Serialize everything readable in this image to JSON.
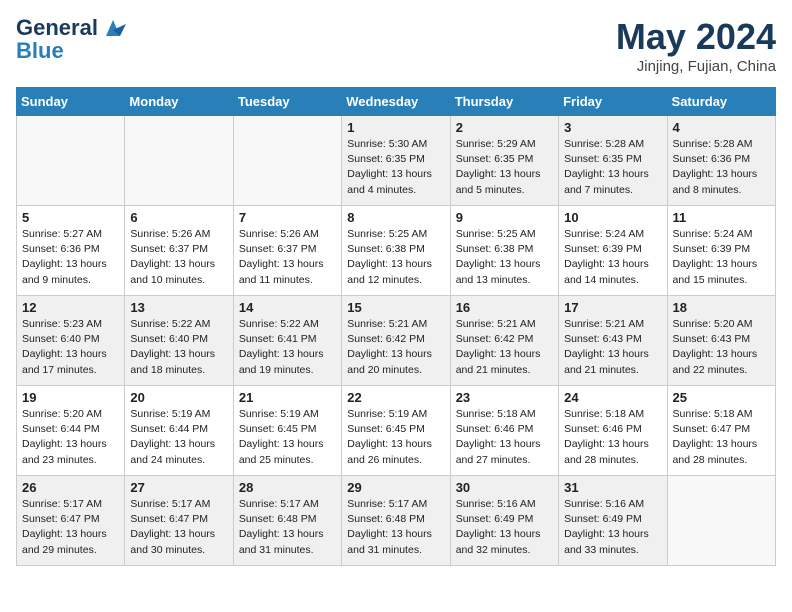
{
  "header": {
    "logo_line1": "General",
    "logo_line2": "Blue",
    "month_title": "May 2024",
    "location": "Jinjing, Fujian, China"
  },
  "weekdays": [
    "Sunday",
    "Monday",
    "Tuesday",
    "Wednesday",
    "Thursday",
    "Friday",
    "Saturday"
  ],
  "rows": [
    [
      {
        "day": "",
        "info": ""
      },
      {
        "day": "",
        "info": ""
      },
      {
        "day": "",
        "info": ""
      },
      {
        "day": "1",
        "info": "Sunrise: 5:30 AM\nSunset: 6:35 PM\nDaylight: 13 hours\nand 4 minutes."
      },
      {
        "day": "2",
        "info": "Sunrise: 5:29 AM\nSunset: 6:35 PM\nDaylight: 13 hours\nand 5 minutes."
      },
      {
        "day": "3",
        "info": "Sunrise: 5:28 AM\nSunset: 6:35 PM\nDaylight: 13 hours\nand 7 minutes."
      },
      {
        "day": "4",
        "info": "Sunrise: 5:28 AM\nSunset: 6:36 PM\nDaylight: 13 hours\nand 8 minutes."
      }
    ],
    [
      {
        "day": "5",
        "info": "Sunrise: 5:27 AM\nSunset: 6:36 PM\nDaylight: 13 hours\nand 9 minutes."
      },
      {
        "day": "6",
        "info": "Sunrise: 5:26 AM\nSunset: 6:37 PM\nDaylight: 13 hours\nand 10 minutes."
      },
      {
        "day": "7",
        "info": "Sunrise: 5:26 AM\nSunset: 6:37 PM\nDaylight: 13 hours\nand 11 minutes."
      },
      {
        "day": "8",
        "info": "Sunrise: 5:25 AM\nSunset: 6:38 PM\nDaylight: 13 hours\nand 12 minutes."
      },
      {
        "day": "9",
        "info": "Sunrise: 5:25 AM\nSunset: 6:38 PM\nDaylight: 13 hours\nand 13 minutes."
      },
      {
        "day": "10",
        "info": "Sunrise: 5:24 AM\nSunset: 6:39 PM\nDaylight: 13 hours\nand 14 minutes."
      },
      {
        "day": "11",
        "info": "Sunrise: 5:24 AM\nSunset: 6:39 PM\nDaylight: 13 hours\nand 15 minutes."
      }
    ],
    [
      {
        "day": "12",
        "info": "Sunrise: 5:23 AM\nSunset: 6:40 PM\nDaylight: 13 hours\nand 17 minutes."
      },
      {
        "day": "13",
        "info": "Sunrise: 5:22 AM\nSunset: 6:40 PM\nDaylight: 13 hours\nand 18 minutes."
      },
      {
        "day": "14",
        "info": "Sunrise: 5:22 AM\nSunset: 6:41 PM\nDaylight: 13 hours\nand 19 minutes."
      },
      {
        "day": "15",
        "info": "Sunrise: 5:21 AM\nSunset: 6:42 PM\nDaylight: 13 hours\nand 20 minutes."
      },
      {
        "day": "16",
        "info": "Sunrise: 5:21 AM\nSunset: 6:42 PM\nDaylight: 13 hours\nand 21 minutes."
      },
      {
        "day": "17",
        "info": "Sunrise: 5:21 AM\nSunset: 6:43 PM\nDaylight: 13 hours\nand 21 minutes."
      },
      {
        "day": "18",
        "info": "Sunrise: 5:20 AM\nSunset: 6:43 PM\nDaylight: 13 hours\nand 22 minutes."
      }
    ],
    [
      {
        "day": "19",
        "info": "Sunrise: 5:20 AM\nSunset: 6:44 PM\nDaylight: 13 hours\nand 23 minutes."
      },
      {
        "day": "20",
        "info": "Sunrise: 5:19 AM\nSunset: 6:44 PM\nDaylight: 13 hours\nand 24 minutes."
      },
      {
        "day": "21",
        "info": "Sunrise: 5:19 AM\nSunset: 6:45 PM\nDaylight: 13 hours\nand 25 minutes."
      },
      {
        "day": "22",
        "info": "Sunrise: 5:19 AM\nSunset: 6:45 PM\nDaylight: 13 hours\nand 26 minutes."
      },
      {
        "day": "23",
        "info": "Sunrise: 5:18 AM\nSunset: 6:46 PM\nDaylight: 13 hours\nand 27 minutes."
      },
      {
        "day": "24",
        "info": "Sunrise: 5:18 AM\nSunset: 6:46 PM\nDaylight: 13 hours\nand 28 minutes."
      },
      {
        "day": "25",
        "info": "Sunrise: 5:18 AM\nSunset: 6:47 PM\nDaylight: 13 hours\nand 28 minutes."
      }
    ],
    [
      {
        "day": "26",
        "info": "Sunrise: 5:17 AM\nSunset: 6:47 PM\nDaylight: 13 hours\nand 29 minutes."
      },
      {
        "day": "27",
        "info": "Sunrise: 5:17 AM\nSunset: 6:47 PM\nDaylight: 13 hours\nand 30 minutes."
      },
      {
        "day": "28",
        "info": "Sunrise: 5:17 AM\nSunset: 6:48 PM\nDaylight: 13 hours\nand 31 minutes."
      },
      {
        "day": "29",
        "info": "Sunrise: 5:17 AM\nSunset: 6:48 PM\nDaylight: 13 hours\nand 31 minutes."
      },
      {
        "day": "30",
        "info": "Sunrise: 5:16 AM\nSunset: 6:49 PM\nDaylight: 13 hours\nand 32 minutes."
      },
      {
        "day": "31",
        "info": "Sunrise: 5:16 AM\nSunset: 6:49 PM\nDaylight: 13 hours\nand 33 minutes."
      },
      {
        "day": "",
        "info": ""
      }
    ]
  ]
}
